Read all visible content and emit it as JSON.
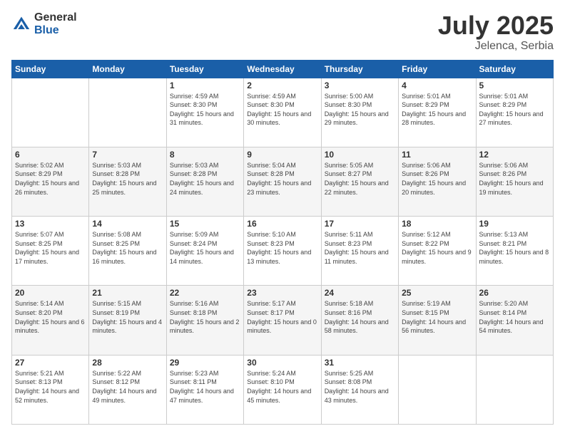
{
  "logo": {
    "general": "General",
    "blue": "Blue"
  },
  "title": {
    "month": "July 2025",
    "location": "Jelenca, Serbia"
  },
  "headers": [
    "Sunday",
    "Monday",
    "Tuesday",
    "Wednesday",
    "Thursday",
    "Friday",
    "Saturday"
  ],
  "weeks": [
    [
      {
        "day": "",
        "info": ""
      },
      {
        "day": "",
        "info": ""
      },
      {
        "day": "1",
        "info": "Sunrise: 4:59 AM\nSunset: 8:30 PM\nDaylight: 15 hours and 31 minutes."
      },
      {
        "day": "2",
        "info": "Sunrise: 4:59 AM\nSunset: 8:30 PM\nDaylight: 15 hours and 30 minutes."
      },
      {
        "day": "3",
        "info": "Sunrise: 5:00 AM\nSunset: 8:30 PM\nDaylight: 15 hours and 29 minutes."
      },
      {
        "day": "4",
        "info": "Sunrise: 5:01 AM\nSunset: 8:29 PM\nDaylight: 15 hours and 28 minutes."
      },
      {
        "day": "5",
        "info": "Sunrise: 5:01 AM\nSunset: 8:29 PM\nDaylight: 15 hours and 27 minutes."
      }
    ],
    [
      {
        "day": "6",
        "info": "Sunrise: 5:02 AM\nSunset: 8:29 PM\nDaylight: 15 hours and 26 minutes."
      },
      {
        "day": "7",
        "info": "Sunrise: 5:03 AM\nSunset: 8:28 PM\nDaylight: 15 hours and 25 minutes."
      },
      {
        "day": "8",
        "info": "Sunrise: 5:03 AM\nSunset: 8:28 PM\nDaylight: 15 hours and 24 minutes."
      },
      {
        "day": "9",
        "info": "Sunrise: 5:04 AM\nSunset: 8:28 PM\nDaylight: 15 hours and 23 minutes."
      },
      {
        "day": "10",
        "info": "Sunrise: 5:05 AM\nSunset: 8:27 PM\nDaylight: 15 hours and 22 minutes."
      },
      {
        "day": "11",
        "info": "Sunrise: 5:06 AM\nSunset: 8:26 PM\nDaylight: 15 hours and 20 minutes."
      },
      {
        "day": "12",
        "info": "Sunrise: 5:06 AM\nSunset: 8:26 PM\nDaylight: 15 hours and 19 minutes."
      }
    ],
    [
      {
        "day": "13",
        "info": "Sunrise: 5:07 AM\nSunset: 8:25 PM\nDaylight: 15 hours and 17 minutes."
      },
      {
        "day": "14",
        "info": "Sunrise: 5:08 AM\nSunset: 8:25 PM\nDaylight: 15 hours and 16 minutes."
      },
      {
        "day": "15",
        "info": "Sunrise: 5:09 AM\nSunset: 8:24 PM\nDaylight: 15 hours and 14 minutes."
      },
      {
        "day": "16",
        "info": "Sunrise: 5:10 AM\nSunset: 8:23 PM\nDaylight: 15 hours and 13 minutes."
      },
      {
        "day": "17",
        "info": "Sunrise: 5:11 AM\nSunset: 8:23 PM\nDaylight: 15 hours and 11 minutes."
      },
      {
        "day": "18",
        "info": "Sunrise: 5:12 AM\nSunset: 8:22 PM\nDaylight: 15 hours and 9 minutes."
      },
      {
        "day": "19",
        "info": "Sunrise: 5:13 AM\nSunset: 8:21 PM\nDaylight: 15 hours and 8 minutes."
      }
    ],
    [
      {
        "day": "20",
        "info": "Sunrise: 5:14 AM\nSunset: 8:20 PM\nDaylight: 15 hours and 6 minutes."
      },
      {
        "day": "21",
        "info": "Sunrise: 5:15 AM\nSunset: 8:19 PM\nDaylight: 15 hours and 4 minutes."
      },
      {
        "day": "22",
        "info": "Sunrise: 5:16 AM\nSunset: 8:18 PM\nDaylight: 15 hours and 2 minutes."
      },
      {
        "day": "23",
        "info": "Sunrise: 5:17 AM\nSunset: 8:17 PM\nDaylight: 15 hours and 0 minutes."
      },
      {
        "day": "24",
        "info": "Sunrise: 5:18 AM\nSunset: 8:16 PM\nDaylight: 14 hours and 58 minutes."
      },
      {
        "day": "25",
        "info": "Sunrise: 5:19 AM\nSunset: 8:15 PM\nDaylight: 14 hours and 56 minutes."
      },
      {
        "day": "26",
        "info": "Sunrise: 5:20 AM\nSunset: 8:14 PM\nDaylight: 14 hours and 54 minutes."
      }
    ],
    [
      {
        "day": "27",
        "info": "Sunrise: 5:21 AM\nSunset: 8:13 PM\nDaylight: 14 hours and 52 minutes."
      },
      {
        "day": "28",
        "info": "Sunrise: 5:22 AM\nSunset: 8:12 PM\nDaylight: 14 hours and 49 minutes."
      },
      {
        "day": "29",
        "info": "Sunrise: 5:23 AM\nSunset: 8:11 PM\nDaylight: 14 hours and 47 minutes."
      },
      {
        "day": "30",
        "info": "Sunrise: 5:24 AM\nSunset: 8:10 PM\nDaylight: 14 hours and 45 minutes."
      },
      {
        "day": "31",
        "info": "Sunrise: 5:25 AM\nSunset: 8:08 PM\nDaylight: 14 hours and 43 minutes."
      },
      {
        "day": "",
        "info": ""
      },
      {
        "day": "",
        "info": ""
      }
    ]
  ]
}
